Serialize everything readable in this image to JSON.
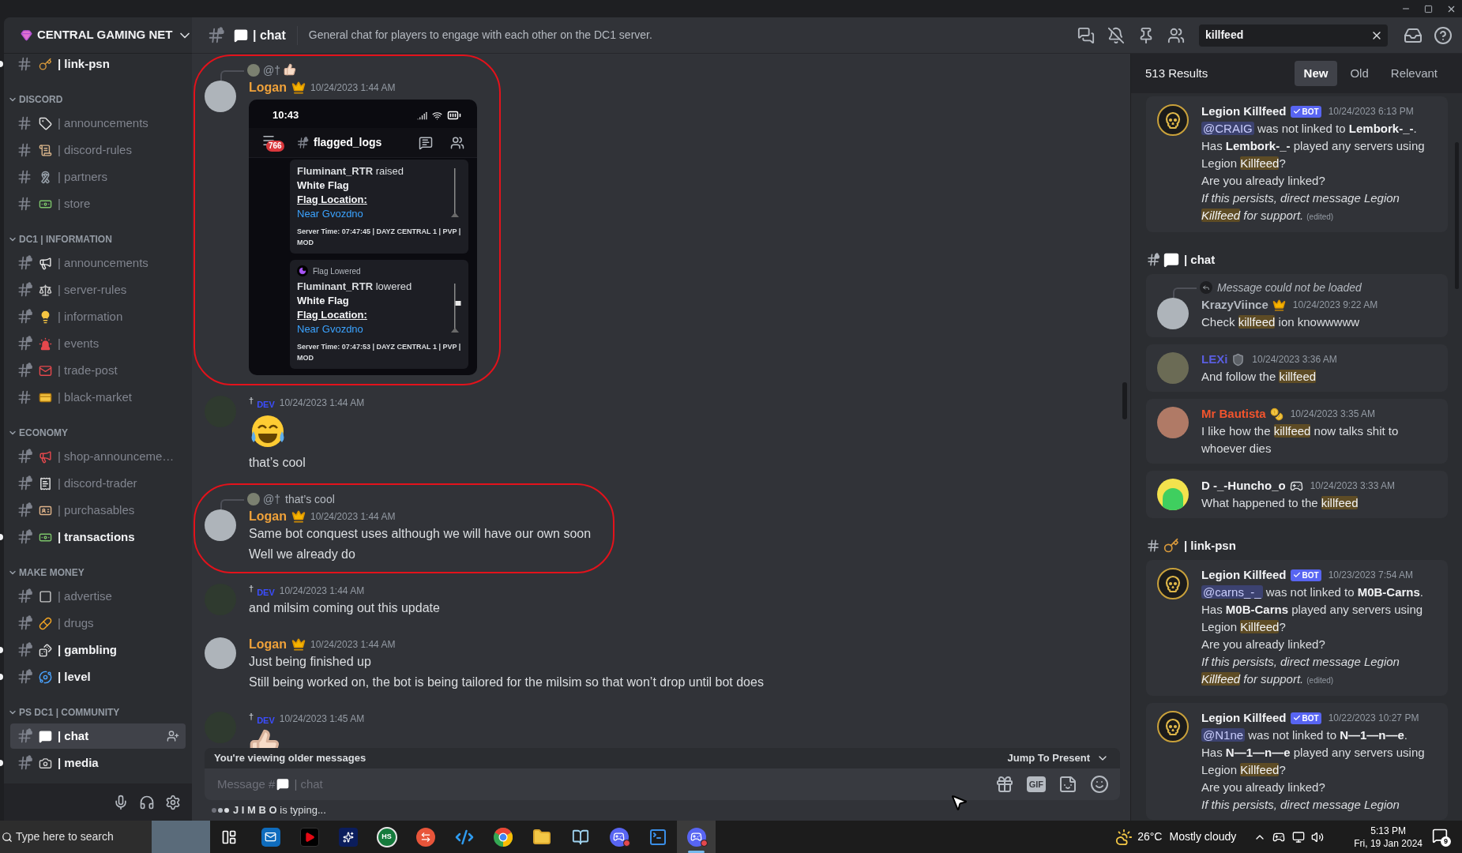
{
  "server": {
    "name": "CENTRAL GAMING NET"
  },
  "sidebar": {
    "sections": [
      {
        "channels": [
          {
            "name": "| link-psn",
            "kind": "key",
            "locked": false,
            "unread": true,
            "selected": false
          }
        ]
      },
      {
        "title": "DISCORD",
        "channels": [
          {
            "name": "| announcements",
            "kind": "tag",
            "locked": false,
            "unread": false,
            "selected": false
          },
          {
            "name": "| discord-rules",
            "kind": "scroll",
            "locked": false,
            "unread": false,
            "selected": false
          },
          {
            "name": "| partners",
            "kind": "ribbon",
            "locked": false,
            "unread": false,
            "selected": false
          },
          {
            "name": "| store",
            "kind": "banknote",
            "locked": false,
            "unread": false,
            "selected": false
          }
        ]
      },
      {
        "title": "DC1 | INFORMATION",
        "channels": [
          {
            "name": "| announcements",
            "kind": "megaphone",
            "locked": true,
            "unread": false,
            "selected": false
          },
          {
            "name": "| server-rules",
            "kind": "scale",
            "locked": true,
            "unread": false,
            "selected": false
          },
          {
            "name": "| information",
            "kind": "bulb",
            "locked": true,
            "unread": false,
            "selected": false
          },
          {
            "name": "| events",
            "kind": "siren",
            "locked": true,
            "unread": false,
            "selected": false
          },
          {
            "name": "| trade-post",
            "kind": "envelope",
            "locked": true,
            "unread": false,
            "selected": false
          },
          {
            "name": "| black-market",
            "kind": "card",
            "locked": false,
            "unread": false,
            "selected": false
          }
        ]
      },
      {
        "title": "ECONOMY",
        "channels": [
          {
            "name": "| shop-announceme…",
            "kind": "loudspeaker",
            "locked": true,
            "unread": false,
            "selected": false
          },
          {
            "name": "| discord-trader",
            "kind": "receipt",
            "locked": true,
            "unread": false,
            "selected": false
          },
          {
            "name": "| purchasables",
            "kind": "idcard",
            "locked": true,
            "unread": false,
            "selected": false
          },
          {
            "name": "| transactions",
            "kind": "banknote",
            "locked": true,
            "unread": true,
            "selected": false
          }
        ]
      },
      {
        "title": "MAKE MONEY",
        "channels": [
          {
            "name": "| advertise",
            "kind": "box",
            "locked": true,
            "unread": false,
            "selected": false
          },
          {
            "name": "| drugs",
            "kind": "pill",
            "locked": true,
            "unread": false,
            "selected": false
          },
          {
            "name": "| gambling",
            "kind": "dice",
            "locked": true,
            "unread": true,
            "selected": false
          },
          {
            "name": "| level",
            "kind": "orbit",
            "locked": true,
            "unread": true,
            "selected": false
          }
        ]
      },
      {
        "title": "PS DC1 | COMMUNITY",
        "channels": [
          {
            "name": "| chat",
            "kind": "speech",
            "locked": true,
            "unread": false,
            "selected": true
          },
          {
            "name": "| media",
            "kind": "camera",
            "locked": true,
            "unread": true,
            "selected": false
          }
        ]
      }
    ]
  },
  "header": {
    "channel": {
      "kind": "speech",
      "locked": true,
      "name": "| chat",
      "topic": "General chat for players to engage with each other on the DC1 server."
    },
    "search": {
      "value": "killfeed"
    }
  },
  "messages": [
    {
      "author": {
        "kind": "crowned",
        "name": "Logan",
        "color": "#f0a23a"
      },
      "time": "10/24/2023 1:44 AM",
      "reply": {
        "kind": "thumbs",
        "mention": "@†"
      },
      "annotated": true,
      "content": [
        {
          "kind": "screenshot",
          "status_time": "10:43",
          "badge": "766",
          "channel": "flagged_logs",
          "embeds": [
            {
              "action": "**Fluminant_RTR** raised",
              "flag": "White Flag",
              "location_label": "Flag Location:",
              "location": "Near Gvozdno",
              "footer": "Server Time: 07:47:45 | DAYZ CENTRAL 1 | PVP | MOD",
              "flag_visible": false
            },
            {
              "title": "Flag Lowered",
              "action": "**Fluminant_RTR** lowered",
              "flag": "White Flag",
              "location_label": "Flag Location:",
              "location": "Near Gvozdno",
              "footer": "Server Time: 07:47:53 | DAYZ CENTRAL 1 | PVP | MOD",
              "flag_visible": true
            }
          ]
        }
      ]
    },
    {
      "author": {
        "kind": "tagged",
        "prefix": "†",
        "name": "DEV",
        "color": "#3b4dff"
      },
      "time": "10/24/2023 1:44 AM",
      "annotated": false,
      "content": [
        {
          "kind": "laughing"
        },
        {
          "kind": "text",
          "text": "that’s cool"
        }
      ]
    },
    {
      "author": {
        "kind": "crowned",
        "name": "Logan",
        "color": "#f0a23a"
      },
      "time": "10/24/2023 1:44 AM",
      "reply": {
        "kind": "text",
        "mention": "@†",
        "text": "that’s cool"
      },
      "annotated": true,
      "content": [
        {
          "kind": "text",
          "text": "Same bot conquest uses although we will have our own soon"
        },
        {
          "kind": "text",
          "text": "Well we already do"
        }
      ]
    },
    {
      "author": {
        "kind": "tagged",
        "prefix": "†",
        "name": "DEV",
        "color": "#3b4dff"
      },
      "time": "10/24/2023 1:44 AM",
      "annotated": false,
      "content": [
        {
          "kind": "text",
          "text": "and milsim coming out this update"
        }
      ]
    },
    {
      "author": {
        "kind": "crowned",
        "name": "Logan",
        "color": "#f0a23a"
      },
      "time": "10/24/2023 1:44 AM",
      "annotated": false,
      "content": [
        {
          "kind": "text",
          "text": "Just being finished up"
        },
        {
          "kind": "text",
          "text": "Still being worked on, the bot is being tailored for the milsim so that won’t drop until bot does"
        }
      ]
    },
    {
      "author": {
        "kind": "tagged",
        "prefix": "†",
        "name": "DEV",
        "color": "#3b4dff"
      },
      "time": "10/24/2023 1:45 AM",
      "annotated": false,
      "content": [
        {
          "kind": "thumbs"
        }
      ]
    }
  ],
  "older_bar": {
    "text": "You're viewing older messages",
    "action": "Jump To Present"
  },
  "composer": {
    "placeholder": "Message #",
    "channel": {
      "kind": "speech",
      "name": "| chat"
    },
    "gif": "GIF"
  },
  "typing": {
    "text": "**J I M B O** is typing..."
  },
  "search_results": {
    "count": "513 Results",
    "sort": [
      {
        "label": "New",
        "selected": true
      },
      {
        "label": "Old",
        "selected": false
      },
      {
        "label": "Relevant",
        "selected": false
      }
    ],
    "groups": [
      {
        "results": [
          {
            "kind": "bot",
            "author": "Legion Killfeed",
            "color": "#f2f3f5",
            "bot": "BOT",
            "time": "10/24/2023 6:13 PM",
            "lines": [
              [
                {
                  "kind": "mention",
                  "text": "@CRAIG"
                },
                {
                  "kind": "plain",
                  "text": " was not linked to "
                },
                {
                  "kind": "bold",
                  "text": "Lembork-_-"
                },
                {
                  "kind": "plain",
                  "text": "."
                }
              ],
              [
                {
                  "kind": "plain",
                  "text": "Has "
                },
                {
                  "kind": "bold",
                  "text": "Lembork-_-"
                },
                {
                  "kind": "plain",
                  "text": " played any servers using Legion "
                },
                {
                  "kind": "highlight",
                  "text": "Killfeed"
                },
                {
                  "kind": "plain",
                  "text": "?"
                }
              ],
              [
                {
                  "kind": "plain",
                  "text": "Are you already linked?"
                }
              ],
              [
                {
                  "kind": "italic",
                  "text": "If this persists, direct message Legion "
                },
                {
                  "kind": "italic_highlight",
                  "text": "Killfeed"
                },
                {
                  "kind": "italic",
                  "text": " for support."
                }
              ]
            ],
            "edited": "(edited)"
          }
        ]
      },
      {
        "channel": {
          "kind": "speech",
          "locked": true,
          "name": "| chat"
        },
        "results": [
          {
            "kind": "crowned",
            "author": "KrazyViince",
            "color": "#b5bac1",
            "reply": "Message could not be loaded",
            "time": "10/24/2023 9:22 AM",
            "lines": [
              [
                {
                  "kind": "plain",
                  "text": "Check "
                },
                {
                  "kind": "highlight",
                  "text": "killfeed"
                },
                {
                  "kind": "plain",
                  "text": " ion knowwwww"
                }
              ]
            ]
          },
          {
            "kind": "helmeted",
            "author": "LEXi",
            "color": "#5a5ee0",
            "time": "10/24/2023 3:36 AM",
            "lines": [
              [
                {
                  "kind": "plain",
                  "text": "And follow the "
                },
                {
                  "kind": "highlight",
                  "text": "killfeed"
                }
              ]
            ]
          },
          {
            "kind": "gold",
            "author": "Mr Bautista",
            "color": "#f2542d",
            "time": "10/24/2023 3:35 AM",
            "lines": [
              [
                {
                  "kind": "plain",
                  "text": "I like how the "
                },
                {
                  "kind": "highlight",
                  "text": "killfeed"
                },
                {
                  "kind": "plain",
                  "text": " now talks shit to whoever dies"
                }
              ]
            ]
          },
          {
            "kind": "gamer",
            "author": "D -_-Huncho_o",
            "color": "#f2f3f5",
            "time": "10/24/2023 3:33 AM",
            "lines": [
              [
                {
                  "kind": "plain",
                  "text": "What happened to the "
                },
                {
                  "kind": "highlight",
                  "text": "killfeed"
                }
              ]
            ]
          }
        ]
      },
      {
        "channel": {
          "kind": "key",
          "locked": false,
          "name": "| link-psn"
        },
        "results": [
          {
            "kind": "bot",
            "author": "Legion Killfeed",
            "color": "#f2f3f5",
            "bot": "BOT",
            "time": "10/23/2023 7:54 AM",
            "lines": [
              [
                {
                  "kind": "mention",
                  "text": "@carns_-_"
                },
                {
                  "kind": "plain",
                  "text": " was not linked to "
                },
                {
                  "kind": "bold",
                  "text": "M0B-Carns"
                },
                {
                  "kind": "plain",
                  "text": "."
                }
              ],
              [
                {
                  "kind": "plain",
                  "text": "Has "
                },
                {
                  "kind": "bold",
                  "text": "M0B-Carns"
                },
                {
                  "kind": "plain",
                  "text": " played any servers using Legion "
                },
                {
                  "kind": "highlight",
                  "text": "Killfeed"
                },
                {
                  "kind": "plain",
                  "text": "?"
                }
              ],
              [
                {
                  "kind": "plain",
                  "text": "Are you already linked?"
                }
              ],
              [
                {
                  "kind": "italic",
                  "text": "If this persists, direct message Legion "
                },
                {
                  "kind": "italic_highlight",
                  "text": "Killfeed"
                },
                {
                  "kind": "italic",
                  "text": " for support."
                }
              ]
            ],
            "edited": "(edited)"
          },
          {
            "kind": "bot",
            "author": "Legion Killfeed",
            "color": "#f2f3f5",
            "bot": "BOT",
            "time": "10/22/2023 10:27 PM",
            "lines": [
              [
                {
                  "kind": "mention",
                  "text": "@N1ne"
                },
                {
                  "kind": "plain",
                  "text": " was not linked to "
                },
                {
                  "kind": "bold",
                  "text": "N—1—n—e"
                },
                {
                  "kind": "plain",
                  "text": "."
                }
              ],
              [
                {
                  "kind": "plain",
                  "text": "Has "
                },
                {
                  "kind": "bold",
                  "text": "N—1—n—e"
                },
                {
                  "kind": "plain",
                  "text": " played any servers using Legion "
                },
                {
                  "kind": "highlight",
                  "text": "Killfeed"
                },
                {
                  "kind": "plain",
                  "text": "?"
                }
              ],
              [
                {
                  "kind": "plain",
                  "text": "Are you already linked?"
                }
              ],
              [
                {
                  "kind": "italic",
                  "text": "If this persists, direct message Legion"
                }
              ]
            ]
          }
        ]
      }
    ]
  },
  "taskbar": {
    "search_placeholder": "Type here to search",
    "apps": [
      {
        "kind": "taskview",
        "selected": false,
        "alert": false
      },
      {
        "kind": "mail",
        "selected": false,
        "alert": false
      },
      {
        "kind": "play",
        "selected": false,
        "alert": false
      },
      {
        "kind": "sparkle",
        "selected": false,
        "alert": false
      },
      {
        "kind": "logo",
        "label": "HS",
        "selected": false,
        "alert": false
      },
      {
        "kind": "arrows",
        "selected": false,
        "alert": false
      },
      {
        "kind": "code",
        "selected": false,
        "alert": false
      },
      {
        "kind": "browser",
        "selected": false,
        "alert": false
      },
      {
        "kind": "folder",
        "selected": false,
        "alert": false
      },
      {
        "kind": "book",
        "selected": false,
        "alert": false
      },
      {
        "kind": "chat",
        "selected": false,
        "alert": true
      },
      {
        "kind": "terminal",
        "selected": false,
        "alert": false
      },
      {
        "kind": "chat",
        "selected": true,
        "alert": true
      }
    ],
    "weather": {
      "temperature": "26°C",
      "condition": "Mostly cloudy"
    },
    "clock": {
      "time": "5:13 PM",
      "date": "Fri, 19 Jan 2024"
    },
    "notifications": "9"
  }
}
